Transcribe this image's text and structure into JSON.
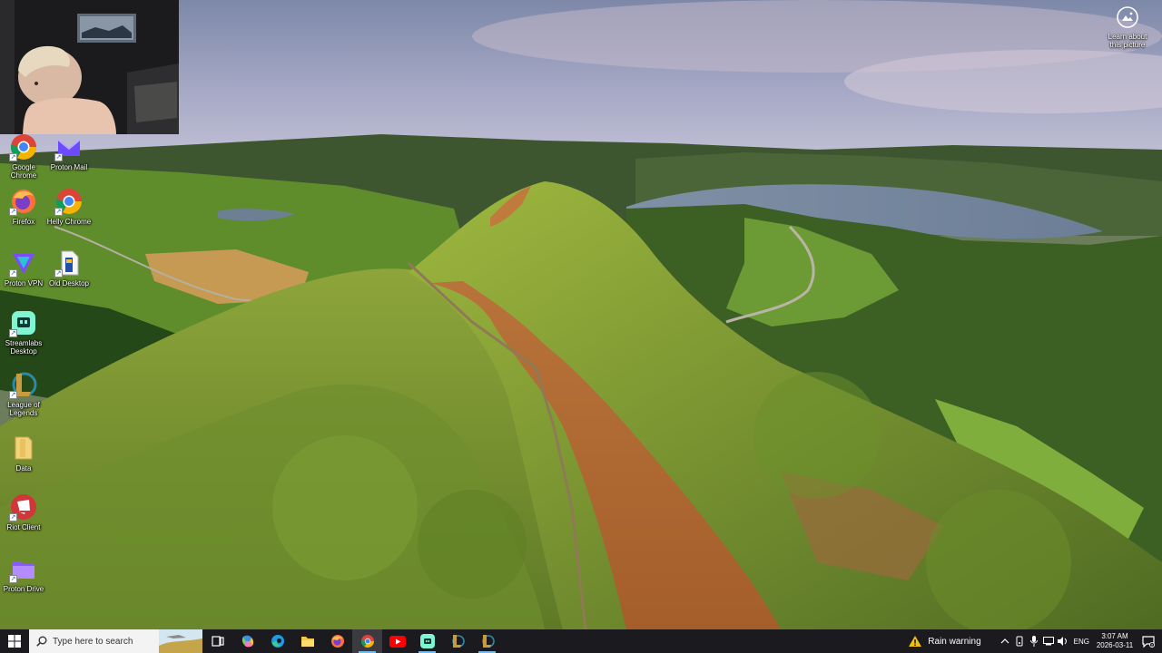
{
  "learn_about_picture": {
    "label": "Learn about this picture",
    "icon": "camera-icon"
  },
  "desktop_icons": [
    {
      "id": "google-chrome",
      "label": "Google Chrome",
      "icon": "chrome-icon"
    },
    {
      "id": "proton-mail",
      "label": "Proton Mail",
      "icon": "proton-mail-icon"
    },
    {
      "id": "firefox",
      "label": "Firefox",
      "icon": "firefox-icon"
    },
    {
      "id": "helium-chrome",
      "label": "Helly Chrome",
      "icon": "chrome-icon"
    },
    {
      "id": "proton-vpn",
      "label": "Proton VPN",
      "icon": "proton-vpn-icon"
    },
    {
      "id": "old-desktop",
      "label": "Old Desktop",
      "icon": "document-icon"
    },
    {
      "id": "streamlabs",
      "label": "Streamlabs Desktop",
      "icon": "streamlabs-icon"
    },
    {
      "id": "league",
      "label": "League of Legends",
      "icon": "league-icon"
    },
    {
      "id": "data",
      "label": "Data",
      "icon": "folder-icon"
    },
    {
      "id": "riot-client",
      "label": "Riot Client",
      "icon": "riot-icon"
    },
    {
      "id": "proton-drive",
      "label": "Proton Drive",
      "icon": "proton-drive-icon"
    }
  ],
  "taskbar": {
    "search_placeholder": "Type here to search",
    "apps": [
      "task-view-icon",
      "copilot-icon",
      "edge-icon",
      "file-explorer-icon",
      "firefox-icon",
      "chrome-icon",
      "youtube-icon",
      "streamlabs-icon",
      "league-icon",
      "league-icon"
    ],
    "weather": "Rain warning",
    "language": "ENG",
    "time": "3:07 AM",
    "date": "2026-03-11"
  },
  "colors": {
    "taskbar_bg": "#1b1b1f",
    "accent": "#76b9ed"
  }
}
